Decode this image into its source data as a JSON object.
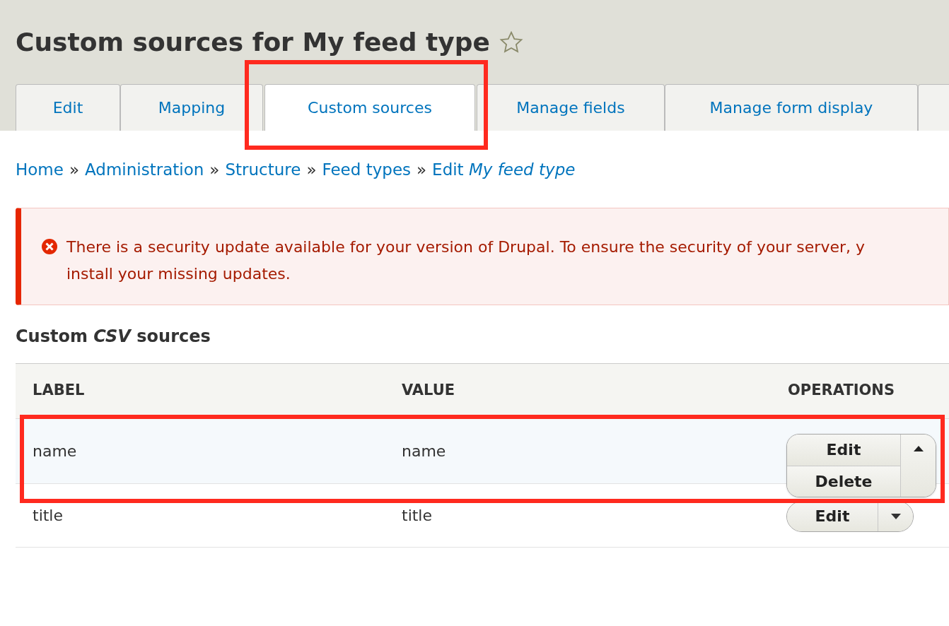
{
  "page_title": "Custom sources for My feed type",
  "favorite": {
    "starred": false
  },
  "tabs": [
    {
      "label": "Edit",
      "selected": false,
      "highlighted": false
    },
    {
      "label": "Mapping",
      "selected": false,
      "highlighted": false
    },
    {
      "label": "Custom sources",
      "selected": true,
      "highlighted": true
    },
    {
      "label": "Manage fields",
      "selected": false,
      "highlighted": false
    },
    {
      "label": "Manage form display",
      "selected": false,
      "highlighted": false
    },
    {
      "selected": false,
      "highlighted": false
    }
  ],
  "breadcrumb": [
    {
      "label": "Home"
    },
    {
      "label": "Administration"
    },
    {
      "label": "Structure"
    },
    {
      "label": "Feed types"
    },
    {
      "label": "Edit *My feed type*"
    }
  ],
  "breadcrumb_separator": "»",
  "message": {
    "text": "There is a security update available for your version of Drupal. To ensure the security of your server, y",
    "text_line_2": "install your missing updates."
  },
  "section_title": "Custom *CSV* sources",
  "table": {
    "columns": [
      "LABEL",
      "VALUE",
      "OPERATIONS"
    ],
    "rows": [
      {
        "label": "name",
        "value": "name",
        "selected": true,
        "highlighted": true,
        "operations": {
          "primary": "Edit",
          "more": [
            "Delete"
          ],
          "expanded": true
        }
      },
      {
        "label": "title",
        "value": "title",
        "selected": false,
        "highlighted": false,
        "operations": {
          "primary": "Edit",
          "expanded": false
        }
      }
    ]
  }
}
